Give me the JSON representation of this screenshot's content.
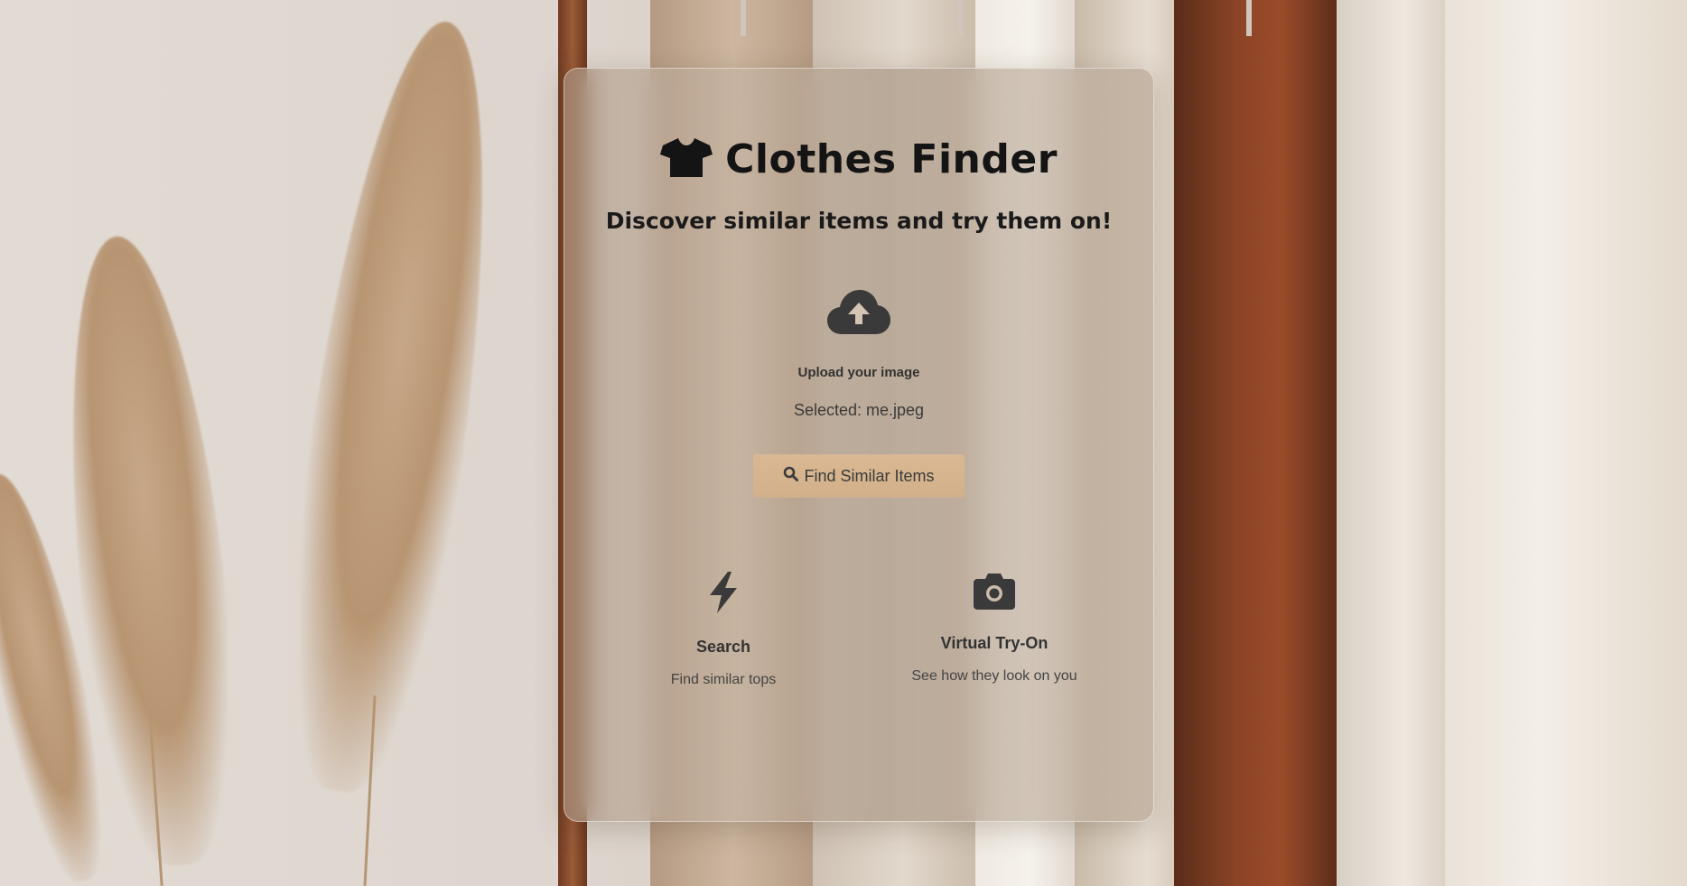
{
  "app": {
    "title": "Clothes Finder",
    "subtitle": "Discover similar items and try them on!"
  },
  "upload": {
    "label": "Upload your image",
    "selected_text": "Selected: me.jpeg",
    "icon": "cloud-upload-icon"
  },
  "actions": {
    "find_label": "Find Similar Items",
    "find_icon": "search-icon"
  },
  "features": [
    {
      "icon": "bolt-icon",
      "title": "Search",
      "description": "Find similar tops"
    },
    {
      "icon": "camera-icon",
      "title": "Virtual Try-On",
      "description": "See how they look on you"
    }
  ],
  "colors": {
    "button_bg": "#d6b48e",
    "title_text": "#141414",
    "icon_dark": "#3a3a3a",
    "card_tint": "#b9a896"
  }
}
